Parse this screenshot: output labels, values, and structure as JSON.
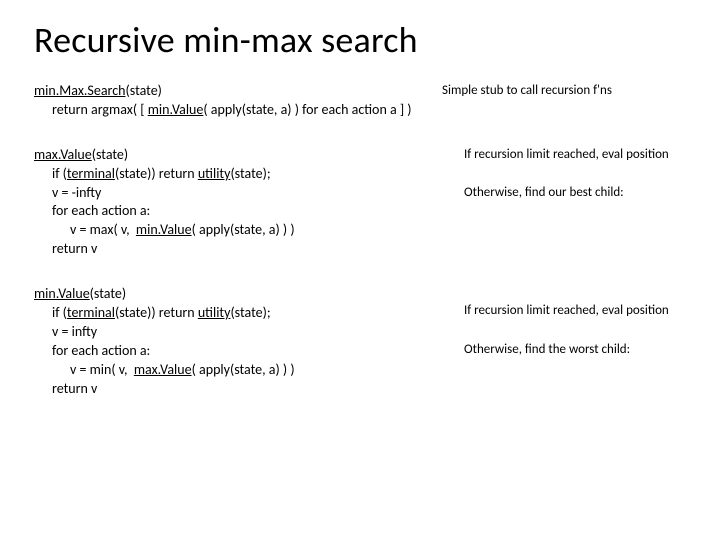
{
  "title": "Recursive min-max search",
  "block1": {
    "fn_name": "min.Max.Search",
    "fn_arg": "(state)",
    "annotation": "Simple stub to call recursion f'ns",
    "body_pre": "return argmax( [ ",
    "body_call": "min.Value",
    "body_post": "( apply(state, a) ) for each action a ] )"
  },
  "block2": {
    "fn_name": "max.Value",
    "fn_arg": "(state)",
    "line_if_pre": "if (",
    "line_if_call": "terminal",
    "line_if_mid": "(state)) return ",
    "line_if_util": "utility",
    "line_if_post": "(state);",
    "line_vinit": "v = -infty",
    "line_for": "for each action a:",
    "line_update_pre": "v = max( v,  ",
    "line_update_call": "min.Value",
    "line_update_post": "( apply(state, a) ) )",
    "line_ret": "return v",
    "anno1": "If recursion limit reached, eval position",
    "anno2": "Otherwise, find our best child:"
  },
  "block3": {
    "fn_name": "min.Value",
    "fn_arg": "(state)",
    "line_if_pre": "if (",
    "line_if_call": "terminal",
    "line_if_mid": "(state)) return ",
    "line_if_util": "utility",
    "line_if_post": "(state);",
    "line_vinit": "v = infty",
    "line_for": "for each action a:",
    "line_update_pre": "v = min( v,  ",
    "line_update_call": "max.Value",
    "line_update_post": "( apply(state, a) ) )",
    "line_ret": "return v",
    "anno1": "If recursion limit reached, eval position",
    "anno2": "Otherwise, find the worst child:"
  }
}
